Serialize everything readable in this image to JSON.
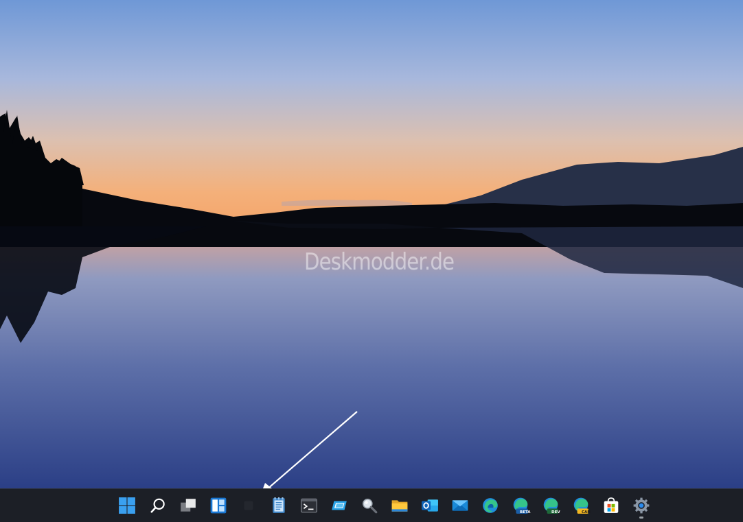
{
  "desktop": {
    "watermark_text": "Deskmodder.de"
  },
  "taskbar": {
    "icons": [
      {
        "name": "start-icon"
      },
      {
        "name": "search-icon"
      },
      {
        "name": "task-view-icon"
      },
      {
        "name": "widgets-icon"
      },
      {
        "name": "empty-slot-icon"
      },
      {
        "name": "notepad-icon"
      },
      {
        "name": "terminal-icon"
      },
      {
        "name": "remote-desktop-icon"
      },
      {
        "name": "magnifier-icon"
      },
      {
        "name": "file-explorer-icon"
      },
      {
        "name": "outlook-icon"
      },
      {
        "name": "mail-icon"
      },
      {
        "name": "edge-icon"
      },
      {
        "name": "edge-beta-icon",
        "badge": "BETA"
      },
      {
        "name": "edge-dev-icon",
        "badge": "DEV"
      },
      {
        "name": "edge-canary-icon",
        "badge": "CAN"
      },
      {
        "name": "microsoft-store-icon"
      },
      {
        "name": "settings-icon",
        "running": true
      }
    ]
  },
  "colors": {
    "taskbar_bg": "#1c1f26",
    "windows_blue": "#3aa0f0",
    "sky_top": "#6f98d6",
    "horizon": "#f4a66a"
  }
}
